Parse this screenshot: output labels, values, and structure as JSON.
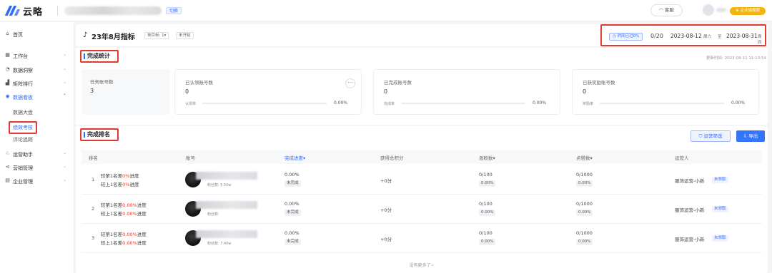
{
  "header": {
    "brand": "云略",
    "switch_label": "切换",
    "customer_service": "客服",
    "vip_label": "企业旗舰版"
  },
  "sidebar": {
    "home": "首页",
    "workbench": "工作台",
    "data_overview": "数据洞察",
    "matrix_rank": "矩阵排行",
    "data_board": "数据看板",
    "sub_items": [
      "数据大盘",
      "绩效考核",
      "评论追踪"
    ],
    "ops_assistant": "运营助手",
    "marketing": "营销管理",
    "enterprise": "企业管理"
  },
  "page": {
    "title": "23年8月指标",
    "tag_single_target": "单目标: 1▾",
    "tag_not_started": "未开始",
    "time_passed": "时间已过0%",
    "days": "0/20",
    "start_date": "2023-08-12",
    "start_week": "周六",
    "date_sep": "至",
    "end_date": "2023-08-31",
    "end_week": "周四"
  },
  "stats": {
    "section_title": "完成统计",
    "update_time": "更新时间: 2023-08-11 11:13:54",
    "task_accounts_label": "任务账号数",
    "task_accounts_value": "3",
    "cards": [
      {
        "title": "已认领账号数",
        "value": "0",
        "bar_label": "认领率",
        "pct": "0.00%",
        "rate": 0
      },
      {
        "title": "已完成账号数",
        "value": "0",
        "bar_label": "完成率",
        "pct": "0.00%",
        "rate": 0
      },
      {
        "title": "已获奖励账号数",
        "value": "0",
        "bar_label": "奖励率",
        "pct": "0.00%",
        "rate": 0
      }
    ],
    "more": "···"
  },
  "ranking": {
    "section_title": "完成排名",
    "filter_button": "运营筛选",
    "export_button": "导出",
    "columns": [
      "排名",
      "账号",
      "完成进度▾",
      "获得总积分",
      "涨粉数▾",
      "点赞数▾",
      "运营人"
    ],
    "rows": [
      {
        "rank": "1",
        "cmp1_pre": "较第1名差",
        "cmp1_val": "0%",
        "cmp1_suf": "进度",
        "cmp2_pre": "较上1名差",
        "cmp2_val": "0%",
        "cmp2_suf": "进度",
        "fans": "粉丝数: 5.50w",
        "progress": "0.00%",
        "status": "未完成",
        "points": "+0分",
        "follower_ratio": "0/100",
        "follower_pct": "0.00%",
        "likes_ratio": "0/1000",
        "likes_pct": "0.00%",
        "operator": "服饰运营-小新",
        "claim": "未领取"
      },
      {
        "rank": "2",
        "cmp1_pre": "较第1名差",
        "cmp1_val": "0.00%",
        "cmp1_suf": "进度",
        "cmp2_pre": "较上1名差",
        "cmp2_val": "0.00%",
        "cmp2_suf": "进度",
        "fans": "粉丝数: ",
        "progress": "0.00%",
        "status": "未完成",
        "points": "+0分",
        "follower_ratio": "0/100",
        "follower_pct": "0.00%",
        "likes_ratio": "0/1000",
        "likes_pct": "0.00%",
        "operator": "服饰运营-小新",
        "claim": "未领取"
      },
      {
        "rank": "3",
        "cmp1_pre": "较第1名差",
        "cmp1_val": "0.00%",
        "cmp1_suf": "进度",
        "cmp2_pre": "较上1名差",
        "cmp2_val": "0.00%",
        "cmp2_suf": "进度",
        "fans": "粉丝数: 7.40w",
        "progress": "0.00%",
        "status": "未完成",
        "points": "+0分",
        "follower_ratio": "0/100",
        "follower_pct": "0.00%",
        "likes_ratio": "0/1000",
        "likes_pct": "0.00%",
        "operator": "服饰运营-小新",
        "claim": "未领取"
      }
    ],
    "no_more": "没有更多了~"
  },
  "colors": {
    "accent": "#2f6bff",
    "highlight_border": "#e23a2e",
    "vip": "#f5b30f"
  }
}
